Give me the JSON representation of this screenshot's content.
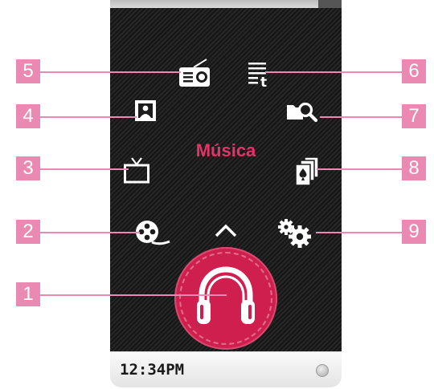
{
  "menu": {
    "title": "Música"
  },
  "status_bar": {
    "time": "12:34PM"
  },
  "icons": {
    "radio": "radio-icon",
    "text": "text-viewer-icon",
    "photo": "photo-icon",
    "search": "folder-search-icon",
    "tv": "tv-icon",
    "cards": "cards-icon",
    "video": "video-reel-icon",
    "settings": "gears-icon",
    "music": "headphones-icon",
    "up": "chevron-up-icon"
  },
  "callouts": [
    "1",
    "2",
    "3",
    "4",
    "5",
    "6",
    "7",
    "8",
    "9"
  ],
  "colors": {
    "accent": "#cf1f4e",
    "title": "#e5336a",
    "callout": "#ea8ab3"
  }
}
